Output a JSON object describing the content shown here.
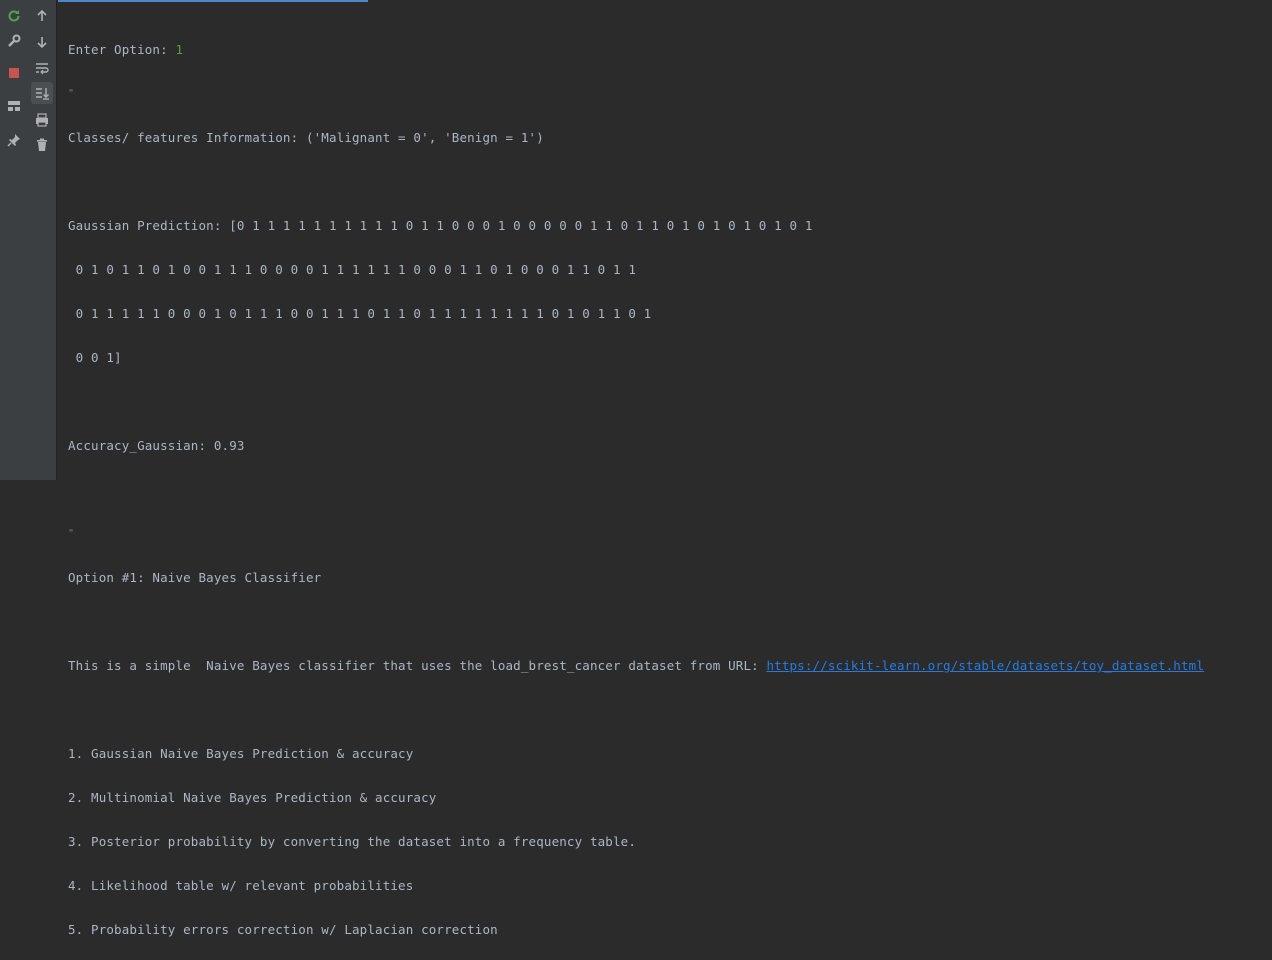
{
  "sidebar_left": {
    "tools": [
      {
        "icon": "rerun-icon",
        "color": "#4fa34a"
      },
      {
        "icon": "wrench-icon"
      },
      {
        "icon": "stop-icon",
        "color": "#c75450"
      },
      {
        "icon": "layout-icon"
      },
      {
        "icon": "pin-icon"
      }
    ]
  },
  "sidebar_right": {
    "tools": [
      {
        "icon": "arrow-up-icon"
      },
      {
        "icon": "arrow-down-icon"
      },
      {
        "icon": "soft-wrap-icon"
      },
      {
        "icon": "scroll-to-end-icon"
      },
      {
        "icon": "print-icon"
      },
      {
        "icon": "trash-icon"
      }
    ]
  },
  "console": {
    "prompt_label": "Enter Option: ",
    "prompt_value": "1",
    "quote_1": "\"",
    "classes_info": "Classes/ features Information: ('Malignant = 0', 'Benign = 1')",
    "gaussian_lines": [
      "Gaussian Prediction: [0 1 1 1 1 1 1 1 1 1 1 0 1 1 0 0 0 1 0 0 0 0 0 1 1 0 1 1 0 1 0 1 0 1 0 1 0 1",
      " 0 1 0 1 1 0 1 0 0 1 1 1 0 0 0 0 1 1 1 1 1 1 0 0 0 1 1 0 1 0 0 0 1 1 0 1 1",
      " 0 1 1 1 1 1 0 0 0 1 0 1 1 1 0 0 1 1 1 0 1 1 0 1 1 1 1 1 1 1 1 0 1 0 1 1 0 1",
      " 0 0 1]"
    ],
    "accuracy": "Accuracy_Gaussian: 0.93",
    "quote_2": "\"",
    "option_title": "Option #1: Naive Bayes Classifier",
    "description_text": "This is a simple  Naive Bayes classifier that uses the load_brest_cancer dataset from URL: ",
    "description_link": "https://scikit-learn.org/stable/datasets/toy_dataset.html",
    "menu_items": [
      "1. Gaussian Naive Bayes Prediction & accuracy",
      "2. Multinomial Naive Bayes Prediction & accuracy",
      "3. Posterior probability by converting the dataset into a frequency table.",
      "4. Likelihood table w/ relevant probabilities",
      "5. Probability errors correction w/ Laplacian correction"
    ]
  }
}
